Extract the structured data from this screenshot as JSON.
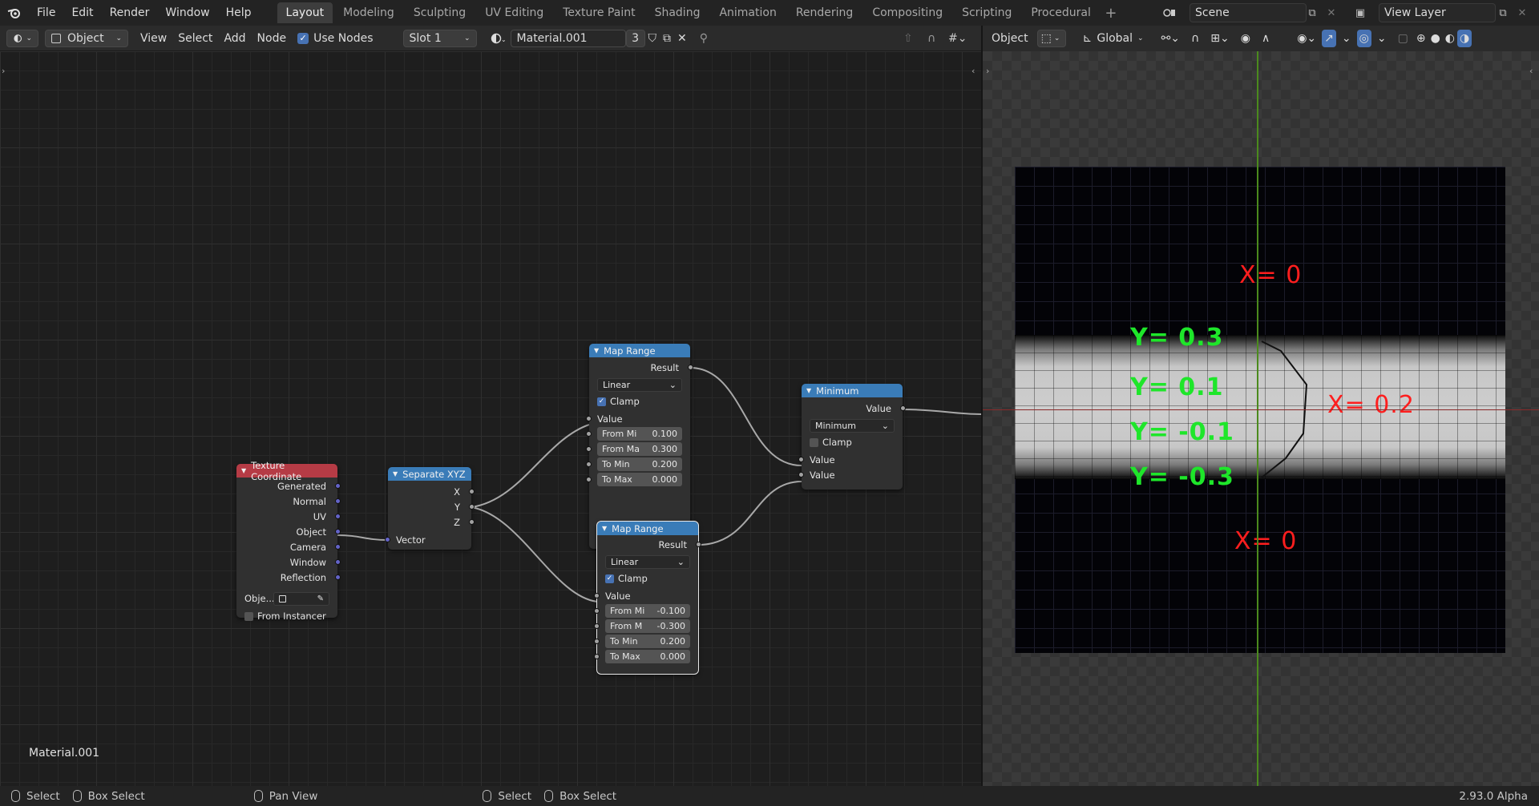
{
  "menu": [
    "File",
    "Edit",
    "Render",
    "Window",
    "Help"
  ],
  "workspaces": [
    "Layout",
    "Modeling",
    "Sculpting",
    "UV Editing",
    "Texture Paint",
    "Shading",
    "Animation",
    "Rendering",
    "Compositing",
    "Scripting",
    "Procedural"
  ],
  "active_workspace": "Layout",
  "scene": "Scene",
  "view_layer": "View Layer",
  "node_header": {
    "mode": "Object",
    "view": "View",
    "select": "Select",
    "add": "Add",
    "node": "Node",
    "use_nodes": "Use Nodes",
    "slot": "Slot 1",
    "material": "Material.001",
    "users": "3"
  },
  "viewport_header": {
    "mode": "Object",
    "orientation": "Global"
  },
  "nodes": {
    "texcoord": {
      "title": "Texture Coordinate",
      "outputs": [
        "Generated",
        "Normal",
        "UV",
        "Object",
        "Camera",
        "Window",
        "Reflection"
      ],
      "object_label": "Obje...",
      "from_instancer": "From Instancer"
    },
    "separate": {
      "title": "Separate XYZ",
      "outputs": [
        "X",
        "Y",
        "Z"
      ],
      "input": "Vector"
    },
    "maprange1": {
      "title": "Map Range",
      "result": "Result",
      "interp": "Linear",
      "clamp": "Clamp",
      "value": "Value",
      "fields": [
        {
          "label": "From Mi",
          "value": "0.100"
        },
        {
          "label": "From Ma",
          "value": "0.300"
        },
        {
          "label": "To Min",
          "value": "0.200"
        },
        {
          "label": "To Max",
          "value": "0.000"
        }
      ]
    },
    "maprange2": {
      "title": "Map Range",
      "result": "Result",
      "interp": "Linear",
      "clamp": "Clamp",
      "value": "Value",
      "fields": [
        {
          "label": "From Mi",
          "value": "-0.100"
        },
        {
          "label": "From M",
          "value": "-0.300"
        },
        {
          "label": "To Min",
          "value": "0.200"
        },
        {
          "label": "To Max",
          "value": "0.000"
        }
      ]
    },
    "minimum": {
      "title": "Minimum",
      "output": "Value",
      "operation": "Minimum",
      "clamp": "Clamp",
      "inputs": [
        "Value",
        "Value"
      ]
    }
  },
  "material_label": "Material.001",
  "annotations": {
    "x_top": "X= 0",
    "y1": "Y= 0.3",
    "y2": "Y= 0.1",
    "y3": "Y= -0.1",
    "y4": "Y= -0.3",
    "x_mid": "X= 0.2",
    "x_bottom": "X= 0"
  },
  "status": {
    "left_select": "Select",
    "left_box": "Box Select",
    "pan": "Pan View",
    "right_select": "Select",
    "right_box": "Box Select",
    "version": "2.93.0 Alpha"
  },
  "colors": {
    "accent": "#4772b3",
    "texcoord_header": "#b53b45",
    "converter_header": "#3a7cb8",
    "annotation_red": "#ff1e1e",
    "annotation_green": "#1ee62a"
  }
}
